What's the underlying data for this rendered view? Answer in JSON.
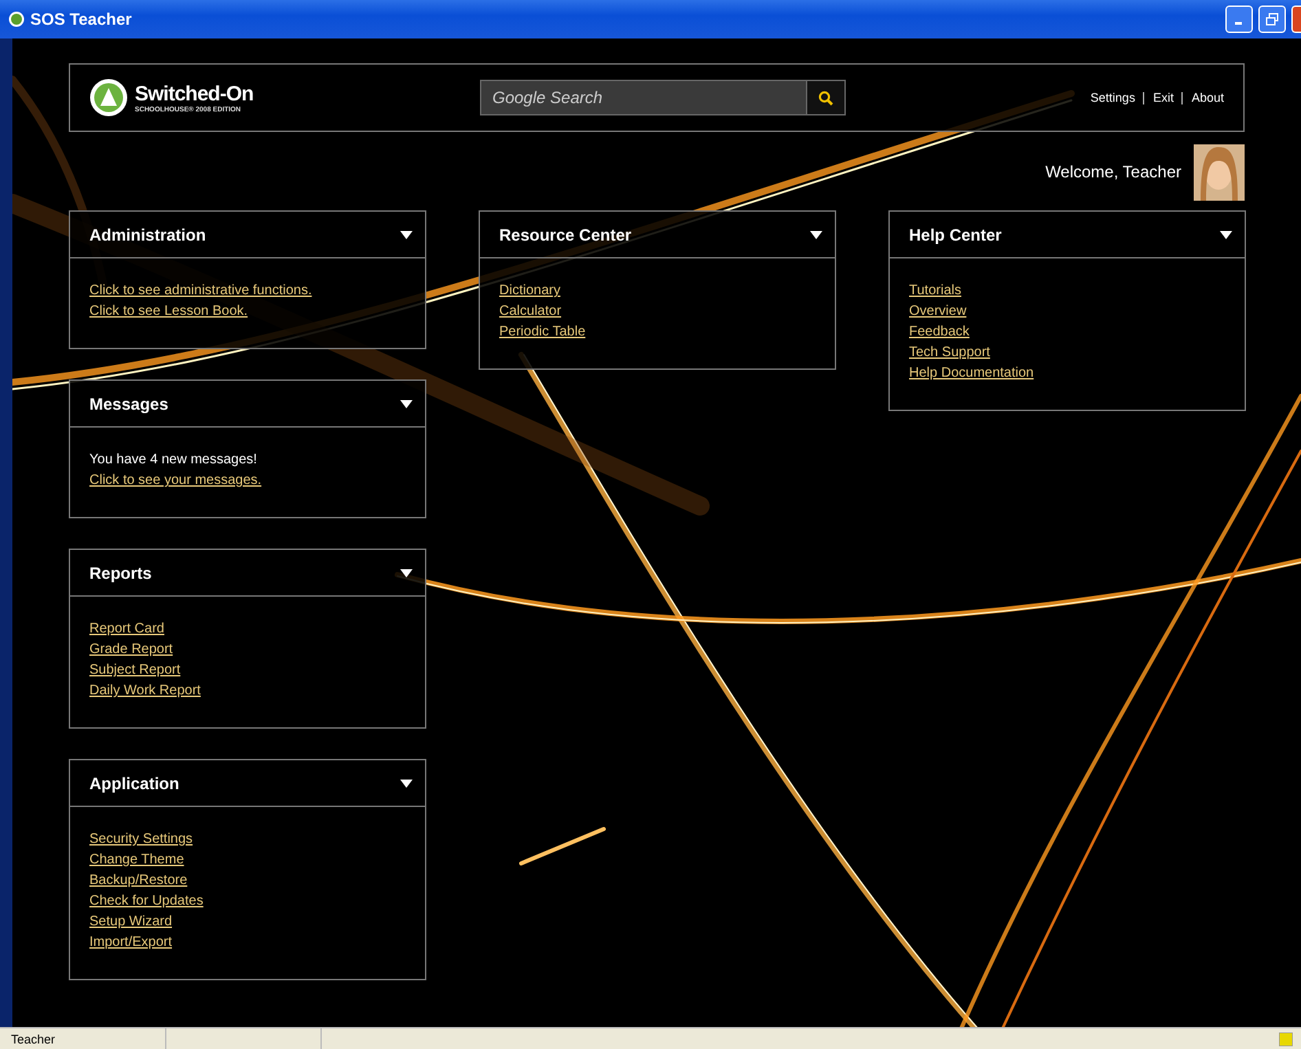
{
  "window": {
    "title": "SOS Teacher"
  },
  "header": {
    "logo": {
      "name": "Switched-On",
      "edition": "SCHOOLHOUSE® 2008 EDITION"
    },
    "search": {
      "placeholder": "Google Search"
    },
    "links": [
      "Settings",
      "Exit",
      "About"
    ]
  },
  "welcome": "Welcome, Teacher",
  "columns": [
    [
      {
        "title": "Administration",
        "items": [
          {
            "kind": "link",
            "text": "Click to see administrative functions."
          },
          {
            "kind": "link",
            "text": "Click to see Lesson Book."
          }
        ]
      },
      {
        "title": "Messages",
        "items": [
          {
            "kind": "text",
            "text": "You have 4 new messages!"
          },
          {
            "kind": "link",
            "text": "Click to see your messages."
          }
        ]
      },
      {
        "title": "Reports",
        "items": [
          {
            "kind": "link",
            "text": "Report Card"
          },
          {
            "kind": "link",
            "text": "Grade Report"
          },
          {
            "kind": "link",
            "text": "Subject Report"
          },
          {
            "kind": "link",
            "text": "Daily Work Report"
          }
        ]
      },
      {
        "title": "Application",
        "items": [
          {
            "kind": "link",
            "text": "Security Settings"
          },
          {
            "kind": "link",
            "text": "Change Theme"
          },
          {
            "kind": "link",
            "text": "Backup/Restore"
          },
          {
            "kind": "link",
            "text": "Check for Updates"
          },
          {
            "kind": "link",
            "text": "Setup Wizard"
          },
          {
            "kind": "link",
            "text": "Import/Export"
          }
        ]
      }
    ],
    [
      {
        "title": "Resource Center",
        "items": [
          {
            "kind": "link",
            "text": "Dictionary"
          },
          {
            "kind": "link",
            "text": "Calculator"
          },
          {
            "kind": "link",
            "text": "Periodic Table"
          }
        ]
      }
    ],
    [
      {
        "title": "Help Center",
        "items": [
          {
            "kind": "link",
            "text": "Tutorials"
          },
          {
            "kind": "link",
            "text": "Overview"
          },
          {
            "kind": "link",
            "text": "Feedback"
          },
          {
            "kind": "link",
            "text": "Tech Support"
          },
          {
            "kind": "link",
            "text": "Help Documentation"
          }
        ]
      }
    ]
  ],
  "status_bar": {
    "panes": [
      "Teacher"
    ]
  }
}
